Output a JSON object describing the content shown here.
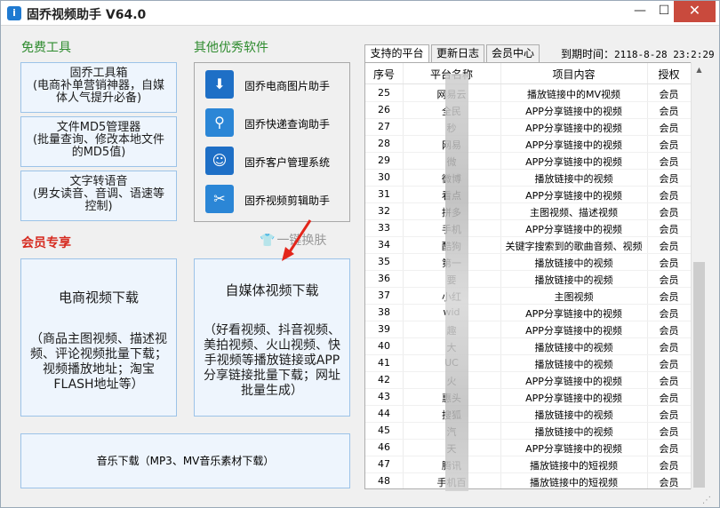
{
  "window": {
    "title": "固乔视频助手 V64.0",
    "min_label": "—",
    "max_label": "☐",
    "close_label": "✕"
  },
  "free_tools": {
    "heading": "免费工具",
    "buttons": [
      {
        "line1": "固乔工具箱",
        "line2": "(电商补单营销神器，自媒",
        "line3": "体人气提升必备)"
      },
      {
        "line1": "文件MD5管理器",
        "line2": "(批量查询、修改本地文件",
        "line3": "的MD5值)"
      },
      {
        "line1": "文字转语音",
        "line2": "(男女读音、音调、语速等",
        "line3": "控制)"
      }
    ]
  },
  "other_software": {
    "heading": "其他优秀软件",
    "items": [
      {
        "label": "固乔电商图片助手",
        "icon": "download-icon"
      },
      {
        "label": "固乔快递查询助手",
        "icon": "express-icon"
      },
      {
        "label": "固乔客户管理系统",
        "icon": "customer-icon"
      },
      {
        "label": "固乔视频剪辑助手",
        "icon": "scissors-icon"
      }
    ]
  },
  "skin": {
    "label": "一键换肤"
  },
  "vip": {
    "heading": "会员专享",
    "ecommerce": {
      "title": "电商视频下载",
      "desc": "（商品主图视频、描述视频、评论视频批量下载；视频播放地址；淘宝FLASH地址等）"
    },
    "media": {
      "title": "自媒体视频下载",
      "desc": "（好看视频、抖音视频、美拍视频、火山视频、快手视频等播放链接或APP分享链接批量下载；网址批量生成）"
    },
    "music": {
      "label": "音乐下载（MP3、MV音乐素材下载）"
    }
  },
  "tabs": [
    "支持的平台",
    "更新日志",
    "会员中心"
  ],
  "expire": {
    "label": "到期时间：",
    "value": "2118-8-28 23:2:29"
  },
  "table": {
    "headers": [
      "序号",
      "平台名称",
      "项目内容",
      "授权"
    ],
    "rows": [
      {
        "no": "25",
        "name": "网易云",
        "content": "播放链接中的MV视频",
        "auth": "会员"
      },
      {
        "no": "26",
        "name": "全民",
        "content": "APP分享链接中的视频",
        "auth": "会员"
      },
      {
        "no": "27",
        "name": "秒",
        "content": "APP分享链接中的视频",
        "auth": "会员"
      },
      {
        "no": "28",
        "name": "网易",
        "content": "APP分享链接中的视频",
        "auth": "会员"
      },
      {
        "no": "29",
        "name": "微",
        "content": "APP分享链接中的视频",
        "auth": "会员"
      },
      {
        "no": "30",
        "name": "微博",
        "content": "播放链接中的视频",
        "auth": "会员"
      },
      {
        "no": "31",
        "name": "看点",
        "content": "APP分享链接中的视频",
        "auth": "会员"
      },
      {
        "no": "32",
        "name": "拼多",
        "content": "主图视频、描述视频",
        "auth": "会员"
      },
      {
        "no": "33",
        "name": "手机",
        "content": "APP分享链接中的视频",
        "auth": "会员"
      },
      {
        "no": "34",
        "name": "酷狗",
        "content": "关键字搜索到的歌曲音频、视频",
        "auth": "会员"
      },
      {
        "no": "35",
        "name": "第一",
        "content": "播放链接中的视频",
        "auth": "会员"
      },
      {
        "no": "36",
        "name": "要",
        "content": "播放链接中的视频",
        "auth": "会员"
      },
      {
        "no": "37",
        "name": "小红",
        "content": "主图视频",
        "auth": "会员"
      },
      {
        "no": "38",
        "name": "wid",
        "content": "APP分享链接中的视频",
        "auth": "会员"
      },
      {
        "no": "39",
        "name": "趣",
        "content": "APP分享链接中的视频",
        "auth": "会员"
      },
      {
        "no": "40",
        "name": "大",
        "content": "播放链接中的视频",
        "auth": "会员"
      },
      {
        "no": "41",
        "name": "UC",
        "content": "播放链接中的视频",
        "auth": "会员"
      },
      {
        "no": "42",
        "name": "火",
        "content": "APP分享链接中的视频",
        "auth": "会员"
      },
      {
        "no": "43",
        "name": "惠头",
        "content": "APP分享链接中的视频",
        "auth": "会员"
      },
      {
        "no": "44",
        "name": "搜狐",
        "content": "播放链接中的视频",
        "auth": "会员"
      },
      {
        "no": "45",
        "name": "汽",
        "content": "播放链接中的视频",
        "auth": "会员"
      },
      {
        "no": "46",
        "name": "天",
        "content": "APP分享链接中的视频",
        "auth": "会员"
      },
      {
        "no": "47",
        "name": "腾讯",
        "content": "播放链接中的短视频",
        "auth": "会员"
      },
      {
        "no": "48",
        "name": "手机百",
        "content": "播放链接中的短视频",
        "auth": "会员"
      }
    ]
  }
}
